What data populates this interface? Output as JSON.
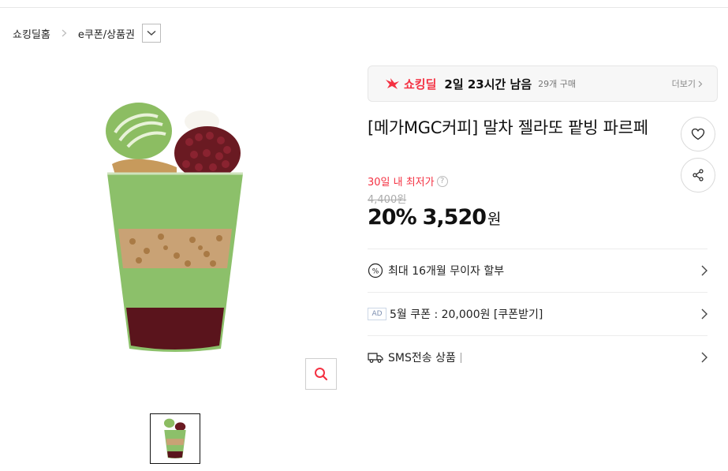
{
  "breadcrumb": {
    "home": "쇼킹딜홈",
    "category": "e쿠폰/상품권"
  },
  "deal": {
    "brand": "쇼킹딜",
    "time_left": "2일 23시간 남음",
    "purchase_count": "29개 구매",
    "more": "더보기"
  },
  "product": {
    "title": "[메가MGC커피] 말차 젤라또 팥빙 파르페",
    "lowest_label": "30일 내 최저가",
    "original_price": "4,400원",
    "discount": "20%",
    "price": "3,520",
    "currency": "원"
  },
  "rows": {
    "installment": "최대 16개월 무이자 할부",
    "ad_badge": "AD",
    "coupon": "5월 쿠폰 : 20,000원 [쿠폰받기]",
    "sms": "SMS전송 상품"
  },
  "colors": {
    "accent": "#f43142",
    "matcha": "#8cc06a",
    "red_bean": "#6a1a22"
  },
  "icons": {
    "breadcrumb_sep": "chevron-right-icon",
    "dropdown": "chevron-down-icon",
    "zoom": "search-icon",
    "wish": "heart-icon",
    "share": "share-icon",
    "installment": "percent-icon",
    "sms": "truck-icon"
  }
}
